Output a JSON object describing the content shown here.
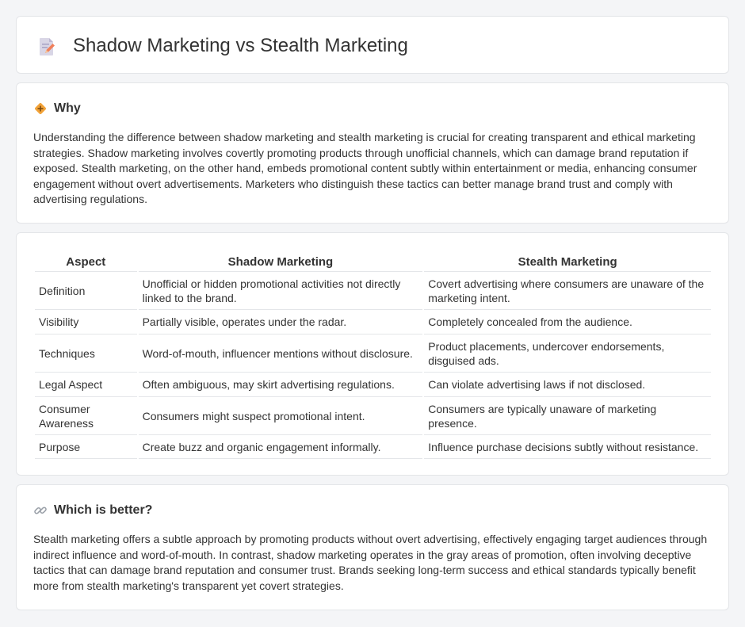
{
  "header": {
    "title": "Shadow Marketing vs Stealth Marketing",
    "icon": "document-pencil-icon"
  },
  "why": {
    "title": "Why",
    "icon": "diamond-sign-icon",
    "body": "Understanding the difference between shadow marketing and stealth marketing is crucial for creating transparent and ethical marketing strategies. Shadow marketing involves covertly promoting products through unofficial channels, which can damage brand reputation if exposed. Stealth marketing, on the other hand, embeds promotional content subtly within entertainment or media, enhancing consumer engagement without overt advertisements. Marketers who distinguish these tactics can better manage brand trust and comply with advertising regulations."
  },
  "comparison": {
    "headers": [
      "Aspect",
      "Shadow Marketing",
      "Stealth Marketing"
    ],
    "rows": [
      [
        "Definition",
        "Unofficial or hidden promotional activities not directly linked to the brand.",
        "Covert advertising where consumers are unaware of the marketing intent."
      ],
      [
        "Visibility",
        "Partially visible, operates under the radar.",
        "Completely concealed from the audience."
      ],
      [
        "Techniques",
        "Word-of-mouth, influencer mentions without disclosure.",
        "Product placements, undercover endorsements, disguised ads."
      ],
      [
        "Legal Aspect",
        "Often ambiguous, may skirt advertising regulations.",
        "Can violate advertising laws if not disclosed."
      ],
      [
        "Consumer Awareness",
        "Consumers might suspect promotional intent.",
        "Consumers are typically unaware of marketing presence."
      ],
      [
        "Purpose",
        "Create buzz and organic engagement informally.",
        "Influence purchase decisions subtly without resistance."
      ]
    ]
  },
  "better": {
    "title": "Which is better?",
    "icon": "link-icon",
    "body": "Stealth marketing offers a subtle approach by promoting products without overt advertising, effectively engaging target audiences through indirect influence and word-of-mouth. In contrast, shadow marketing operates in the gray areas of promotion, often involving deceptive tactics that can damage brand reputation and consumer trust. Brands seeking long-term success and ethical standards typically benefit more from stealth marketing's transparent yet covert strategies."
  },
  "colors": {
    "background": "#f4f5f7",
    "card": "#ffffff",
    "border": "#e3e5e8",
    "text": "#333333",
    "accent_orange": "#f2a33a"
  }
}
